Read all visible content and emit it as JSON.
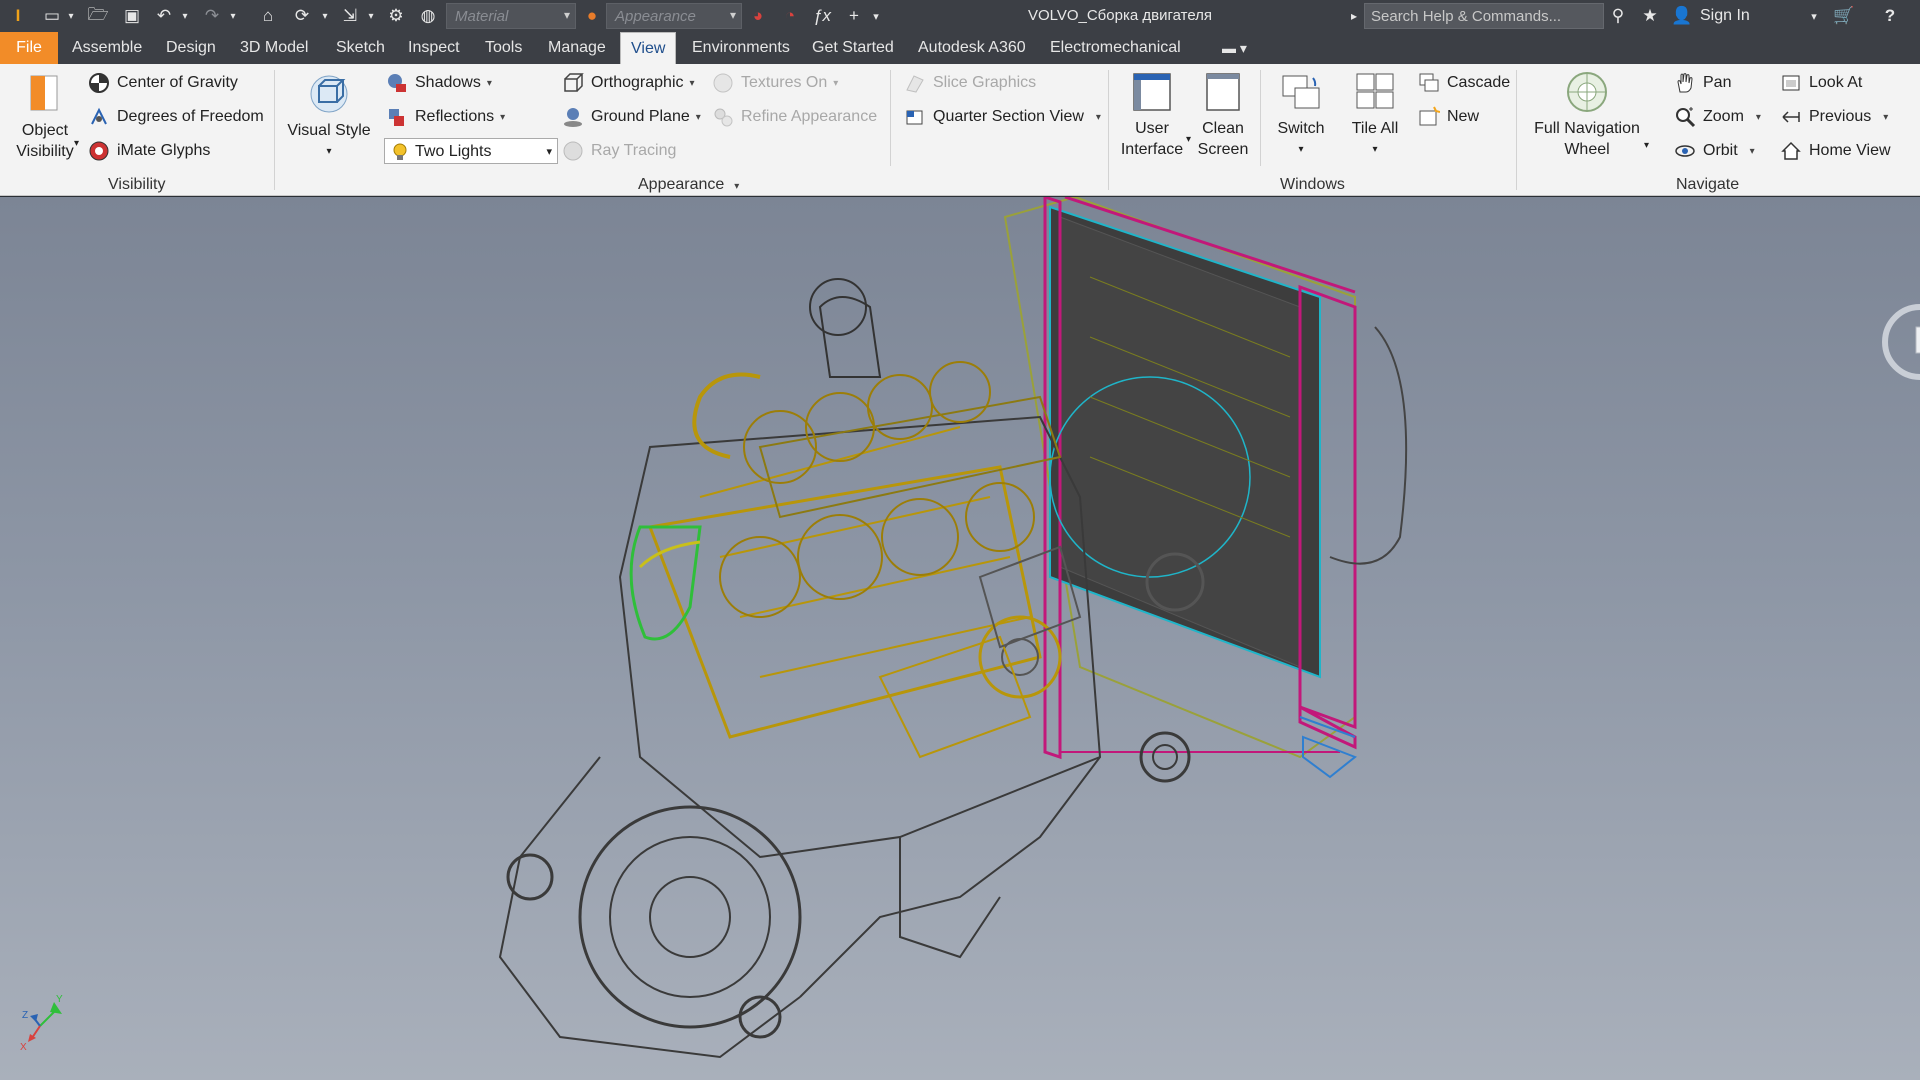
{
  "titlebar": {
    "material_placeholder": "Material",
    "appearance_placeholder": "Appearance",
    "doc_title": "VOLVO_Сборка двигателя",
    "search_placeholder": "Search Help & Commands...",
    "sign_in": "Sign In"
  },
  "tabs": [
    "File",
    "Assemble",
    "Design",
    "3D Model",
    "Sketch",
    "Inspect",
    "Tools",
    "Manage",
    "View",
    "Environments",
    "Get Started",
    "Autodesk A360",
    "Electromechanical"
  ],
  "active_tab": "View",
  "ribbon": {
    "visibility": {
      "object_visibility": [
        "Object",
        "Visibility"
      ],
      "center_of_gravity": "Center of Gravity",
      "degrees_of_freedom": "Degrees of Freedom",
      "imate_glyphs": "iMate Glyphs",
      "panel": "Visibility"
    },
    "appearance": {
      "visual_style": "Visual Style",
      "shadows": "Shadows",
      "reflections": "Reflections",
      "lighting": "Two Lights",
      "orthographic": "Orthographic",
      "ground_plane": "Ground Plane",
      "ray_tracing": "Ray Tracing",
      "textures_on": "Textures On",
      "refine_appearance": "Refine Appearance",
      "slice_graphics": "Slice Graphics",
      "quarter_section_view": "Quarter Section View",
      "panel": "Appearance"
    },
    "windows": {
      "user_interface": [
        "User",
        "Interface"
      ],
      "clean_screen": [
        "Clean",
        "Screen"
      ],
      "switch": "Switch",
      "tile_all": "Tile All",
      "cascade": "Cascade",
      "new": "New",
      "panel": "Windows"
    },
    "navigate": {
      "full_navigation_wheel": [
        "Full Navigation",
        "Wheel"
      ],
      "pan": "Pan",
      "zoom": "Zoom",
      "orbit": "Orbit",
      "look_at": "Look At",
      "previous": "Previous",
      "home_view": "Home View",
      "panel": "Navigate"
    }
  },
  "triad": {
    "x": "X",
    "y": "Y",
    "z": "Z"
  },
  "colors": {
    "file_tab": "#f28c28",
    "engine_wire": "#b8960a",
    "engine_dark": "#3a3a3a",
    "radiator_frame": "#c2187a",
    "radiator_core": "#3d3d3d",
    "hose_green": "#2fbf3a",
    "cyan_lines": "#1fb5c9"
  }
}
